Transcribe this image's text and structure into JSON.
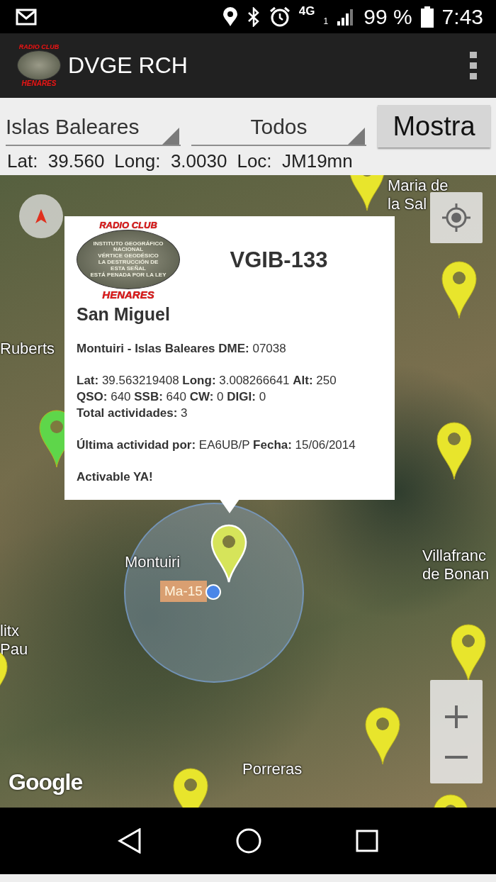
{
  "status_bar": {
    "network": "4G",
    "sim": "1",
    "battery": "99 %",
    "time": "7:43"
  },
  "app_bar": {
    "title": "DVGE RCH",
    "logo": {
      "top": "RADIO CLUB",
      "bottom": "HENARES"
    }
  },
  "filters": {
    "region": "Islas Baleares",
    "type": "Todos",
    "button": "Mostra"
  },
  "position": [
    {
      "label": "Lat:",
      "value": "39.560"
    },
    {
      "label": "Long:",
      "value": "3.0030"
    },
    {
      "label": "Loc:",
      "value": "JM19mn"
    }
  ],
  "map": {
    "labels": [
      {
        "lines": [
          "Maria de",
          "la Sal"
        ]
      },
      {
        "lines": [
          "Ruberts"
        ]
      },
      {
        "lines": [
          "Montuiri"
        ]
      },
      {
        "lines": [
          "Villafranc",
          "de Bonan"
        ]
      },
      {
        "lines": [
          "litx",
          "Pau"
        ]
      },
      {
        "lines": [
          "Porreras"
        ]
      }
    ],
    "road": "Ma-15",
    "markers": [
      {
        "color": "#e8e52c",
        "selected": false
      },
      {
        "color": "#e8e52c",
        "selected": false
      },
      {
        "color": "#e8e52c",
        "selected": false
      },
      {
        "color": "#e8e52c",
        "selected": false
      },
      {
        "color": "#e8e52c",
        "selected": false
      },
      {
        "color": "#e8e52c",
        "selected": false
      },
      {
        "color": "#e8e52c",
        "selected": false
      },
      {
        "color": "#d6e45a",
        "selected": true
      },
      {
        "color": "#5ed64a",
        "selected": false
      },
      {
        "color": "#e8e52c",
        "selected": false
      }
    ],
    "attribution": "Google",
    "popup": {
      "logo": {
        "top": "RADIO CLUB",
        "lines": [
          "INSTITUTO GEOGRÁFICO",
          "NACIONAL",
          "VÉRTICE GEODÉSICO",
          "LA DESTRUCCIÓN DE",
          "ESTA SEÑAL",
          "ESTÁ PENADA POR LA LEY"
        ],
        "bottom": "HENARES"
      },
      "code": "VGIB-133",
      "name": "San Miguel",
      "paragraphs": [
        [
          "**Montuiri - Islas Baleares DME:** 07038"
        ],
        [
          "**Lat:** 39.563219408 **Long:** 3.008266641 **Alt:** 250",
          "**QSO:** 640 **SSB:** 640 **CW:** 0 **DIGI:** 0",
          "**Total actividades:** 3"
        ],
        [
          "**Última actividad por:** EA6UB/P **Fecha:** 15/06/2014"
        ],
        [
          "**Activable YA!**"
        ]
      ]
    }
  }
}
